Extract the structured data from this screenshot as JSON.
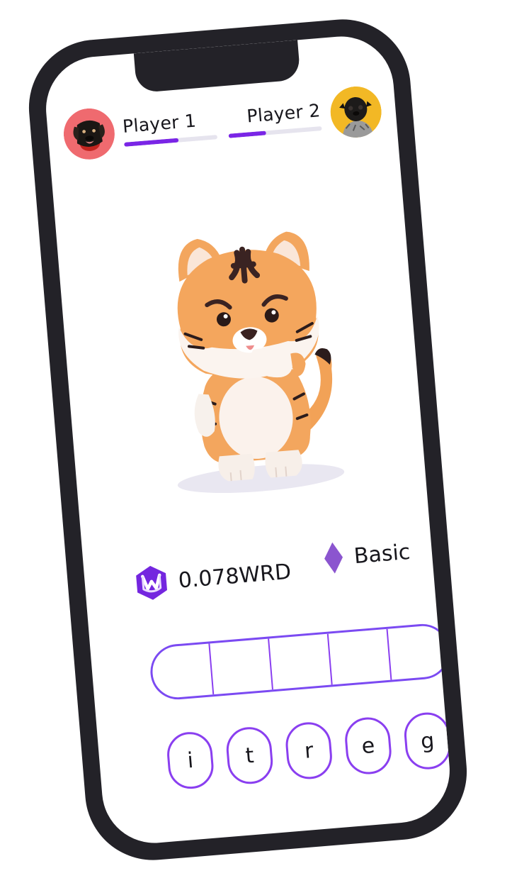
{
  "players": [
    {
      "name": "Player 1",
      "progress": 0.58,
      "avatar_bg": "#ef6a6f",
      "avatar_icon": "dog-icon"
    },
    {
      "name": "Player 2",
      "progress": 0.4,
      "avatar_bg": "#f2b825",
      "avatar_icon": "pug-icon"
    }
  ],
  "mascot": {
    "icon": "tiger-icon"
  },
  "token": {
    "amount": "0.078WRD",
    "icon": "wrd-token-icon",
    "color": "#7426df"
  },
  "tier": {
    "label": "Basic",
    "icon": "diamond-icon",
    "color": "#8b55cf"
  },
  "answer": {
    "slot_count": 5,
    "border_color": "#8a3ff0"
  },
  "letters": [
    "i",
    "t",
    "r",
    "e",
    "g"
  ],
  "colors": {
    "frame": "#232228",
    "accent": "#7a25e6"
  }
}
